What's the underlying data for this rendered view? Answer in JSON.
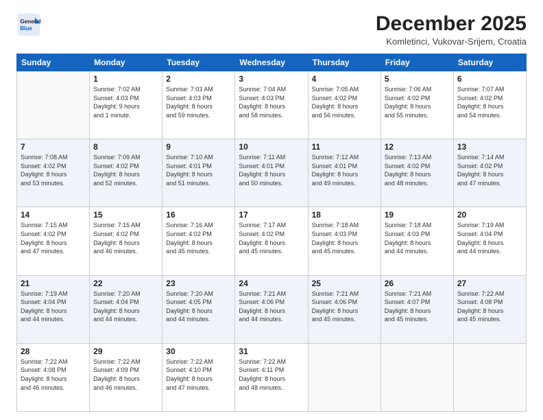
{
  "logo": {
    "line1": "General",
    "line2": "Blue"
  },
  "title": "December 2025",
  "location": "Komletinci, Vukovar-Srijem, Croatia",
  "weekdays": [
    "Sunday",
    "Monday",
    "Tuesday",
    "Wednesday",
    "Thursday",
    "Friday",
    "Saturday"
  ],
  "weeks": [
    [
      {
        "day": "",
        "info": ""
      },
      {
        "day": "1",
        "info": "Sunrise: 7:02 AM\nSunset: 4:03 PM\nDaylight: 9 hours\nand 1 minute."
      },
      {
        "day": "2",
        "info": "Sunrise: 7:03 AM\nSunset: 4:03 PM\nDaylight: 8 hours\nand 59 minutes."
      },
      {
        "day": "3",
        "info": "Sunrise: 7:04 AM\nSunset: 4:03 PM\nDaylight: 8 hours\nand 58 minutes."
      },
      {
        "day": "4",
        "info": "Sunrise: 7:05 AM\nSunset: 4:02 PM\nDaylight: 8 hours\nand 56 minutes."
      },
      {
        "day": "5",
        "info": "Sunrise: 7:06 AM\nSunset: 4:02 PM\nDaylight: 8 hours\nand 55 minutes."
      },
      {
        "day": "6",
        "info": "Sunrise: 7:07 AM\nSunset: 4:02 PM\nDaylight: 8 hours\nand 54 minutes."
      }
    ],
    [
      {
        "day": "7",
        "info": "Sunrise: 7:08 AM\nSunset: 4:02 PM\nDaylight: 8 hours\nand 53 minutes."
      },
      {
        "day": "8",
        "info": "Sunrise: 7:09 AM\nSunset: 4:02 PM\nDaylight: 8 hours\nand 52 minutes."
      },
      {
        "day": "9",
        "info": "Sunrise: 7:10 AM\nSunset: 4:01 PM\nDaylight: 8 hours\nand 51 minutes."
      },
      {
        "day": "10",
        "info": "Sunrise: 7:11 AM\nSunset: 4:01 PM\nDaylight: 8 hours\nand 50 minutes."
      },
      {
        "day": "11",
        "info": "Sunrise: 7:12 AM\nSunset: 4:01 PM\nDaylight: 8 hours\nand 49 minutes."
      },
      {
        "day": "12",
        "info": "Sunrise: 7:13 AM\nSunset: 4:02 PM\nDaylight: 8 hours\nand 48 minutes."
      },
      {
        "day": "13",
        "info": "Sunrise: 7:14 AM\nSunset: 4:02 PM\nDaylight: 8 hours\nand 47 minutes."
      }
    ],
    [
      {
        "day": "14",
        "info": "Sunrise: 7:15 AM\nSunset: 4:02 PM\nDaylight: 8 hours\nand 47 minutes."
      },
      {
        "day": "15",
        "info": "Sunrise: 7:15 AM\nSunset: 4:02 PM\nDaylight: 8 hours\nand 46 minutes."
      },
      {
        "day": "16",
        "info": "Sunrise: 7:16 AM\nSunset: 4:02 PM\nDaylight: 8 hours\nand 45 minutes."
      },
      {
        "day": "17",
        "info": "Sunrise: 7:17 AM\nSunset: 4:02 PM\nDaylight: 8 hours\nand 45 minutes."
      },
      {
        "day": "18",
        "info": "Sunrise: 7:18 AM\nSunset: 4:03 PM\nDaylight: 8 hours\nand 45 minutes."
      },
      {
        "day": "19",
        "info": "Sunrise: 7:18 AM\nSunset: 4:03 PM\nDaylight: 8 hours\nand 44 minutes."
      },
      {
        "day": "20",
        "info": "Sunrise: 7:19 AM\nSunset: 4:04 PM\nDaylight: 8 hours\nand 44 minutes."
      }
    ],
    [
      {
        "day": "21",
        "info": "Sunrise: 7:19 AM\nSunset: 4:04 PM\nDaylight: 8 hours\nand 44 minutes."
      },
      {
        "day": "22",
        "info": "Sunrise: 7:20 AM\nSunset: 4:04 PM\nDaylight: 8 hours\nand 44 minutes."
      },
      {
        "day": "23",
        "info": "Sunrise: 7:20 AM\nSunset: 4:05 PM\nDaylight: 8 hours\nand 44 minutes."
      },
      {
        "day": "24",
        "info": "Sunrise: 7:21 AM\nSunset: 4:06 PM\nDaylight: 8 hours\nand 44 minutes."
      },
      {
        "day": "25",
        "info": "Sunrise: 7:21 AM\nSunset: 4:06 PM\nDaylight: 8 hours\nand 45 minutes."
      },
      {
        "day": "26",
        "info": "Sunrise: 7:21 AM\nSunset: 4:07 PM\nDaylight: 8 hours\nand 45 minutes."
      },
      {
        "day": "27",
        "info": "Sunrise: 7:22 AM\nSunset: 4:08 PM\nDaylight: 8 hours\nand 45 minutes."
      }
    ],
    [
      {
        "day": "28",
        "info": "Sunrise: 7:22 AM\nSunset: 4:08 PM\nDaylight: 8 hours\nand 46 minutes."
      },
      {
        "day": "29",
        "info": "Sunrise: 7:22 AM\nSunset: 4:09 PM\nDaylight: 8 hours\nand 46 minutes."
      },
      {
        "day": "30",
        "info": "Sunrise: 7:22 AM\nSunset: 4:10 PM\nDaylight: 8 hours\nand 47 minutes."
      },
      {
        "day": "31",
        "info": "Sunrise: 7:22 AM\nSunset: 4:11 PM\nDaylight: 8 hours\nand 48 minutes."
      },
      {
        "day": "",
        "info": ""
      },
      {
        "day": "",
        "info": ""
      },
      {
        "day": "",
        "info": ""
      }
    ]
  ]
}
